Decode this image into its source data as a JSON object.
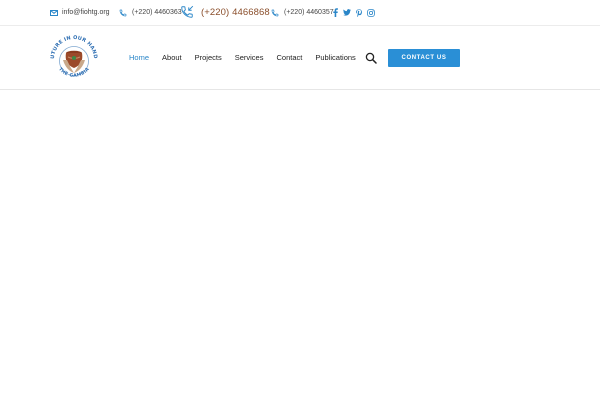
{
  "topbar": {
    "email": "info@fiohtg.org",
    "phone_primary": "(+220) 4460363",
    "phone_featured": "(+220) 4466868",
    "phone_secondary": "(+220) 4460357",
    "icons": {
      "email": "envelope-icon",
      "phone": "phone-icon",
      "featured_phone": "phone-incoming-icon"
    },
    "socials": [
      {
        "name": "facebook-icon",
        "glyph": "f"
      },
      {
        "name": "twitter-icon",
        "glyph": "t"
      },
      {
        "name": "pinterest-icon",
        "glyph": "p"
      },
      {
        "name": "instagram-icon",
        "glyph": "instagram"
      }
    ]
  },
  "logo": {
    "top_text": "FUTURE IN OUR HANDS",
    "bottom_text": "THE GAMBIA"
  },
  "nav": {
    "items": [
      {
        "label": "Home",
        "active": true
      },
      {
        "label": "About",
        "active": false
      },
      {
        "label": "Projects",
        "active": false
      },
      {
        "label": "Services",
        "active": false
      },
      {
        "label": "Contact",
        "active": false
      },
      {
        "label": "Publications",
        "active": false
      }
    ]
  },
  "header": {
    "contact_button_label": "CONTACT US",
    "search_icon": "search-icon"
  },
  "colors": {
    "accent": "#2a86c8",
    "button": "#2a8fd6",
    "featured_phone": "#8a4e2b",
    "logo_ring": "#2f6fb3"
  }
}
